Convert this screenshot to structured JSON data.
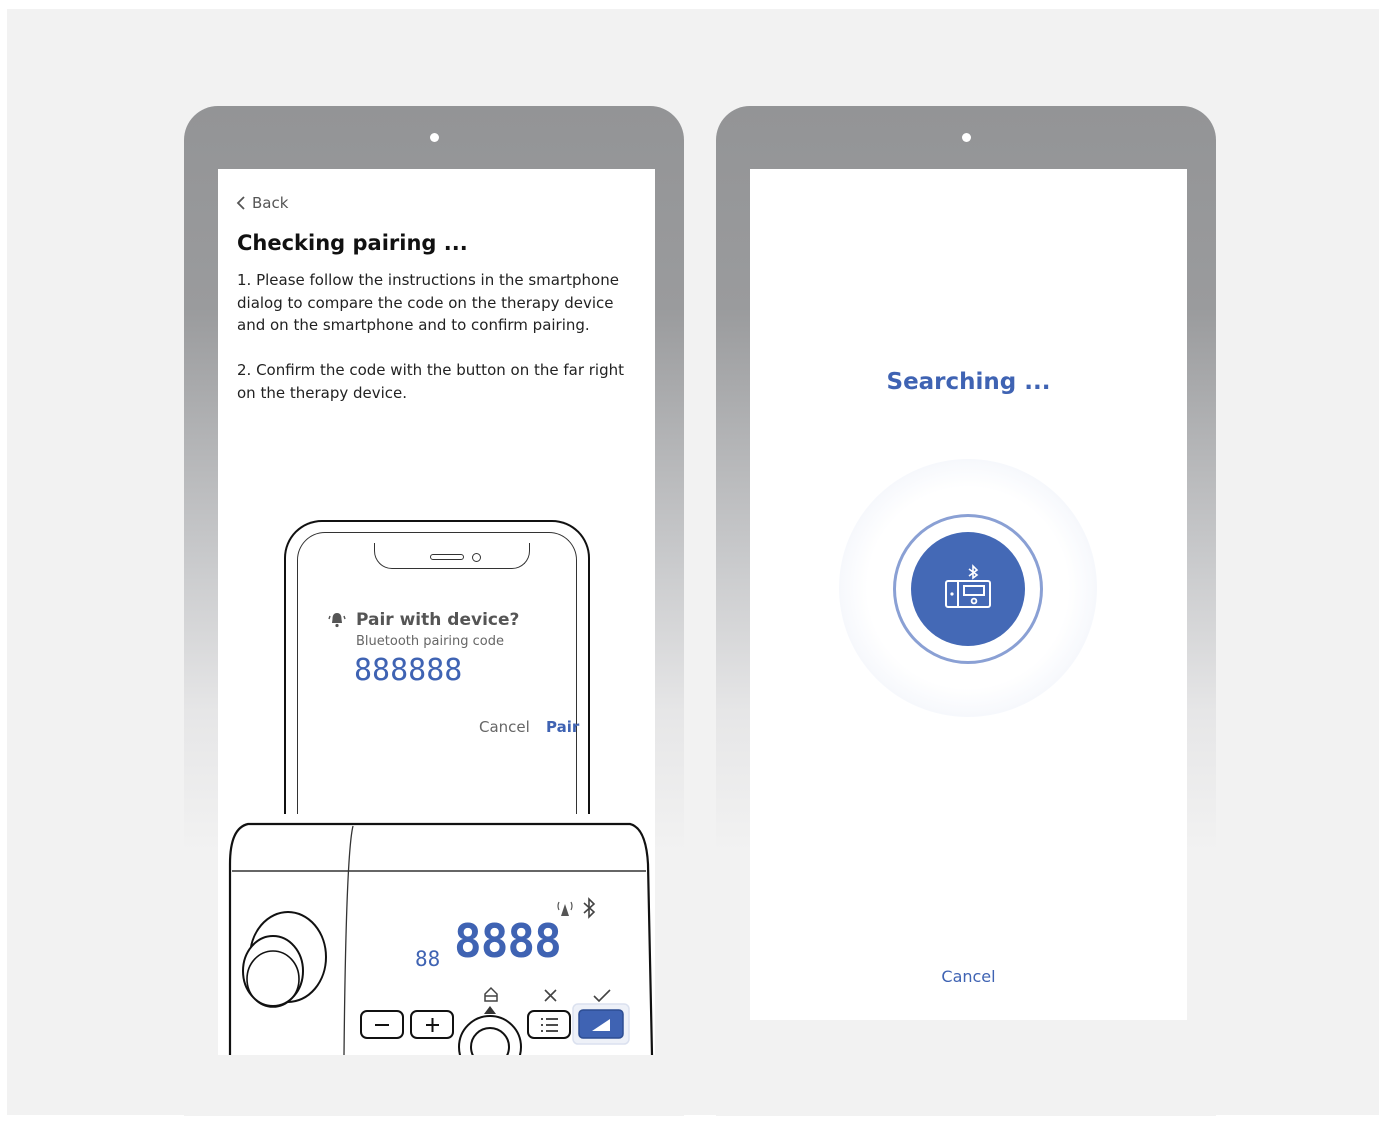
{
  "left_screen": {
    "back_label": "Back",
    "title": "Checking pairing ...",
    "instruction_1": "1. Please follow the instructions in the smartphone dialog to compare the code on the therapy device and on the smartphone and to confirm pairing.",
    "instruction_2": "2. Confirm the code with the button on the far right on the therapy device.",
    "phone_dialog": {
      "title": "Pair with device?",
      "subtitle": "Bluetooth pairing code",
      "code": "888888",
      "cancel": "Cancel",
      "pair": "Pair"
    },
    "device_display": {
      "small_digits": "88",
      "large_digits": "8888"
    }
  },
  "right_screen": {
    "status": "Searching ...",
    "cancel": "Cancel"
  },
  "colors": {
    "accent": "#3f63b3",
    "core": "#4469b6",
    "ring": "#8aa0d4"
  },
  "icons": [
    "chevron-left-icon",
    "bell-icon",
    "bluetooth-icon",
    "wireless-signal-icon",
    "home-icon",
    "cross-icon",
    "check-icon",
    "list-icon",
    "ramp-icon",
    "minus-icon",
    "plus-icon",
    "therapy-device-bluetooth-icon"
  ]
}
